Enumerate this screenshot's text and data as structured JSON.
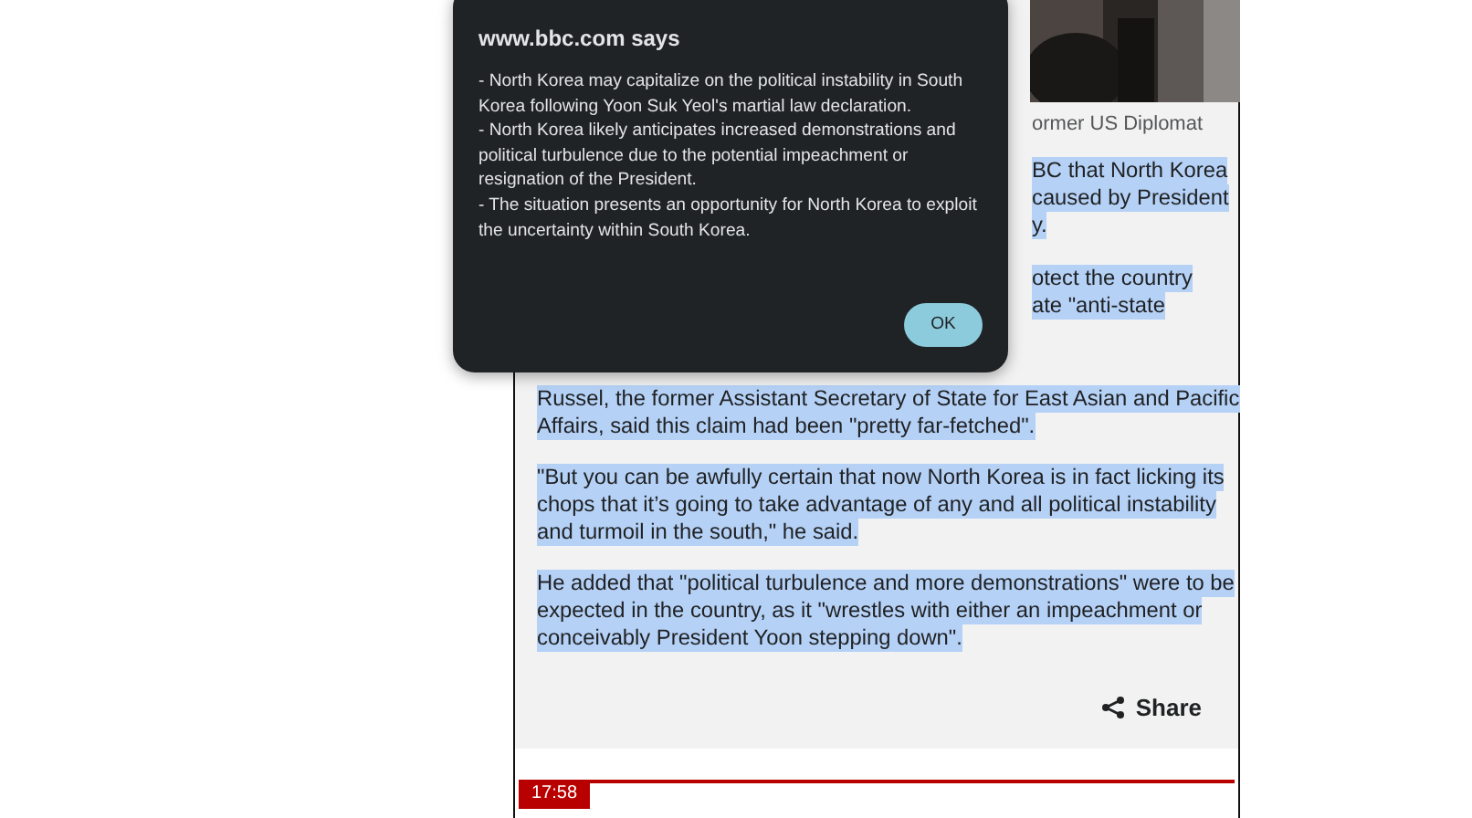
{
  "article": {
    "caption": "ormer US Diplomat",
    "fragments": [
      {
        "lines": [
          "BC that North Korea",
          "caused by President",
          "y."
        ],
        "selected": true
      },
      {
        "lines": [
          "otect the country",
          "ate \"anti-state"
        ],
        "selected": true
      }
    ],
    "paragraphs": [
      {
        "lines": [
          "Russel, the former Assistant Secretary of State for East Asian and Pacific",
          "Affairs, said this claim had been \"pretty far-fetched\"."
        ],
        "selected": true
      },
      {
        "lines": [
          "\"But you can be awfully certain that now North Korea is in fact licking its",
          "chops that it’s going to take advantage of any and all political instability",
          "and turmoil in the south,\" he said."
        ],
        "selected": true
      },
      {
        "lines": [
          "He added that \"political turbulence and more demonstrations\" were to be",
          "expected in the country, as it \"wrestles with either an impeachment or",
          "conceivably President Yoon stepping down\"."
        ],
        "selected": true
      }
    ],
    "share": "Share"
  },
  "next_post": {
    "time": "17:58"
  },
  "dialog": {
    "title": "www.bbc.com says",
    "lines": [
      "- North Korea may capitalize on the political instability in South Korea following Yoon Suk Yeol's martial law declaration.",
      "- North Korea likely anticipates increased demonstrations and political turbulence due to the potential impeachment or resignation of the President.",
      "- The situation presents an opportunity for North Korea to exploit the uncertainty within South Korea."
    ],
    "buttons": [
      {
        "label": "OK"
      }
    ]
  }
}
